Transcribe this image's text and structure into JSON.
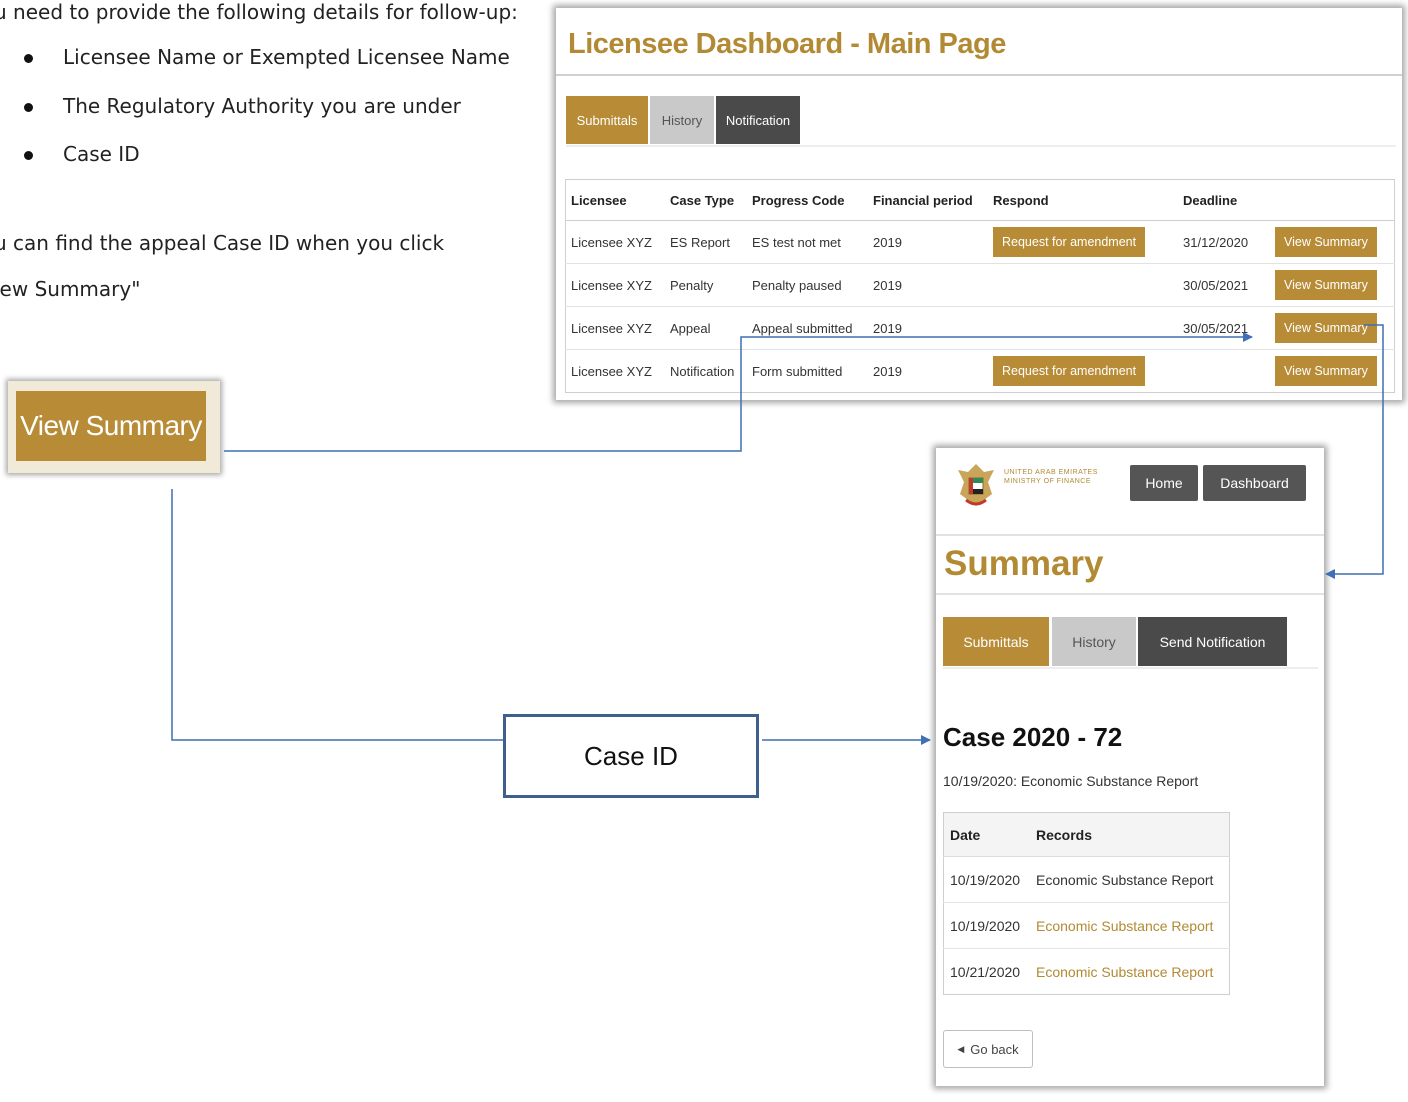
{
  "intro": {
    "line1": "u need to provide the following details for follow-up:",
    "bullets": [
      "Licensee Name or Exempted Licensee Name",
      "The Regulatory Authority you are under",
      "Case ID"
    ],
    "line2": "u can find the appeal Case ID when you click",
    "line3": "iew Summary\""
  },
  "dashboard": {
    "title": "Licensee Dashboard - Main Page",
    "tabs": [
      "Submittals",
      "History",
      "Notification"
    ],
    "columns": [
      "Licensee",
      "Case Type",
      "Progress Code",
      "Financial period",
      "Respond",
      "Deadline",
      ""
    ],
    "rows": [
      {
        "licensee": "Licensee XYZ",
        "case_type": "ES Report",
        "progress": "ES test not met",
        "period": "2019",
        "respond": "Request for amendment",
        "deadline": "31/12/2020",
        "action": "View Summary"
      },
      {
        "licensee": "Licensee XYZ",
        "case_type": "Penalty",
        "progress": "Penalty paused",
        "period": "2019",
        "respond": "",
        "deadline": "30/05/2021",
        "action": "View Summary"
      },
      {
        "licensee": "Licensee XYZ",
        "case_type": "Appeal",
        "progress": "Appeal submitted",
        "period": "2019",
        "respond": "",
        "deadline": "30/05/2021",
        "action": "View Summary"
      },
      {
        "licensee": "Licensee XYZ",
        "case_type": "Notification",
        "progress": "Form submitted",
        "period": "2019",
        "respond": "Request for amendment",
        "deadline": "",
        "action": "View Summary"
      }
    ]
  },
  "callout": {
    "big_button": "View Summary",
    "case_id_label": "Case ID"
  },
  "summary": {
    "logo_line1": "UNITED ARAB EMIRATES",
    "logo_line2": "MINISTRY OF FINANCE",
    "nav_home": "Home",
    "nav_dashboard": "Dashboard",
    "title": "Summary",
    "tabs": [
      "Submittals",
      "History",
      "Send Notification"
    ],
    "case_title": "Case 2020 - 72",
    "case_sub": "10/19/2020: Economic Substance Report",
    "columns": [
      "Date",
      "Records"
    ],
    "records": [
      {
        "date": "10/19/2020",
        "record": "Economic Substance Report"
      },
      {
        "date": "10/19/2020",
        "record": "Economic Substance Report"
      },
      {
        "date": "10/21/2020",
        "record": "Economic Substance Report"
      }
    ],
    "back": "Go back"
  },
  "colors": {
    "gold": "#b88c36",
    "dark": "#4a4a4a",
    "grey": "#c9c9c9",
    "connector": "#3f6fb4"
  }
}
